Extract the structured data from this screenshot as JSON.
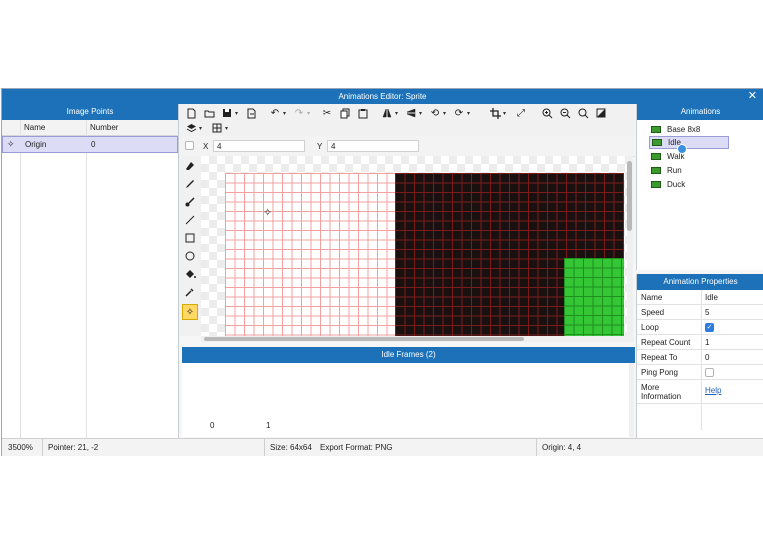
{
  "window": {
    "title": "Animations Editor: Sprite",
    "close_glyph": "✕"
  },
  "image_points": {
    "title": "Image Points",
    "columns": [
      "Name",
      "Number"
    ],
    "rows": [
      {
        "name": "Origin",
        "number": "0"
      }
    ]
  },
  "toolbar": {
    "icons": [
      "new-file-icon",
      "open-folder-icon",
      "save-icon",
      "export-icon",
      "undo-icon",
      "redo-icon",
      "cut-icon",
      "copy-icon",
      "paste-icon",
      "flip-icon",
      "mirror-icon",
      "rotate-ccw-icon",
      "rotate-cw-icon",
      "crop-icon",
      "resize-icon",
      "zoom-in-icon",
      "zoom-out-icon",
      "zoom-fit-icon",
      "grid-toggle-icon",
      "layers-icon",
      "tiles-icon"
    ]
  },
  "coords": {
    "x_label": "X",
    "x_value": "4",
    "y_label": "Y",
    "y_value": "4"
  },
  "tools": [
    "eraser-icon",
    "pencil-icon",
    "brush-icon",
    "line-icon",
    "rectangle-icon",
    "ellipse-icon",
    "fill-bucket-icon",
    "eyedropper-icon",
    "origin-point-icon"
  ],
  "frames": {
    "title": "Idle Frames (2)",
    "labels": [
      "0",
      "1"
    ]
  },
  "animations": {
    "title": "Animations",
    "items": [
      "Base 8x8",
      "Idle",
      "Walk",
      "Run",
      "Duck"
    ],
    "selected": "Idle"
  },
  "properties": {
    "title": "Animation Properties",
    "name_label": "Name",
    "name_value": "Idle",
    "speed_label": "Speed",
    "speed_value": "5",
    "loop_label": "Loop",
    "loop_checked": true,
    "repeat_count_label": "Repeat Count",
    "repeat_count_value": "1",
    "repeat_to_label": "Repeat To",
    "repeat_to_value": "0",
    "ping_pong_label": "Ping Pong",
    "ping_pong_checked": false,
    "more_info_label": "More Information",
    "help_link": "Help"
  },
  "status": {
    "zoom": "3500%",
    "pointer": "Pointer: 21, -2",
    "size": "Size: 64x64",
    "export_format": "Export Format: PNG",
    "origin": "Origin: 4, 4"
  },
  "colors": {
    "accent": "#1c71b8",
    "selection": "#dcdcf6",
    "sprite_green": "#35c635",
    "sprite_dark": "#1a1010",
    "grid_red": "#f2a0a0"
  }
}
